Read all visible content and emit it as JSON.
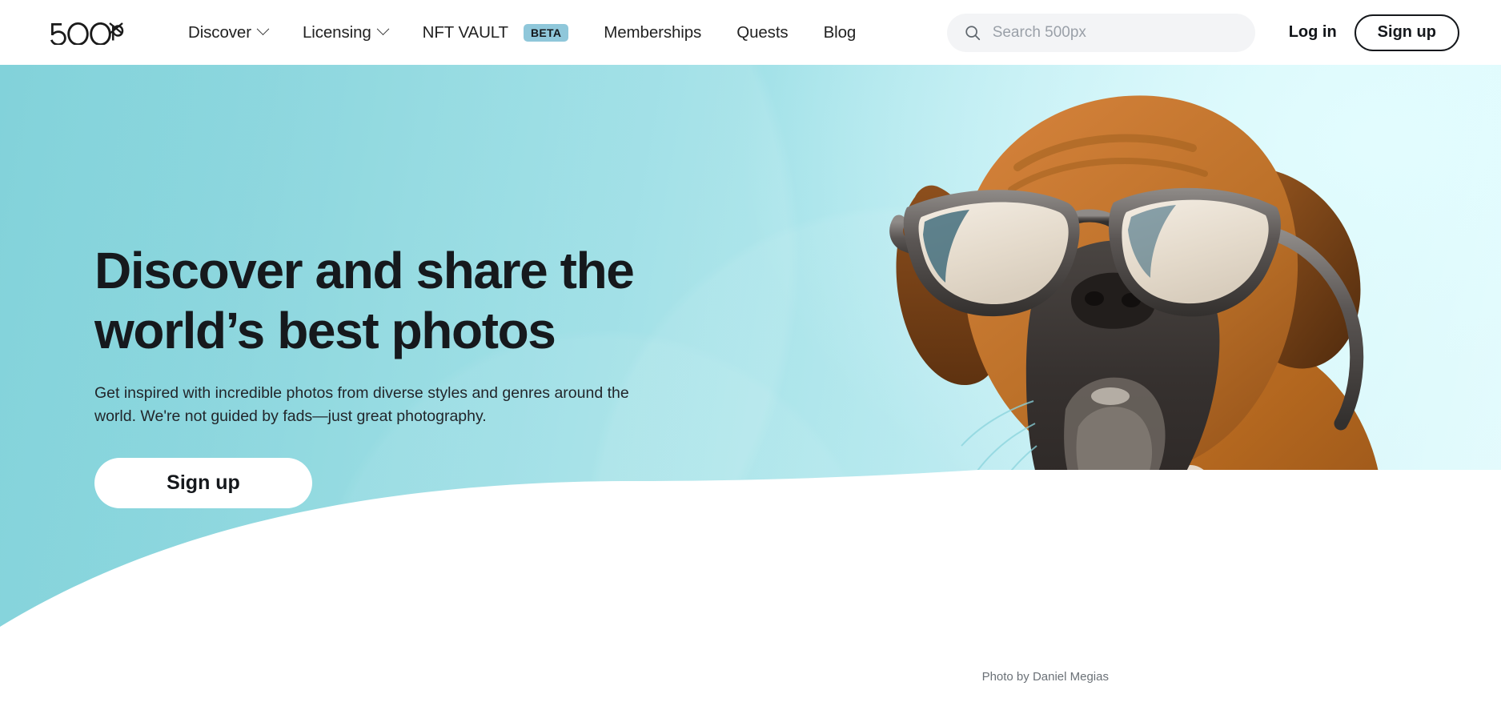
{
  "brand": {
    "logo_text": "500px",
    "logo_icon": "500px-logo"
  },
  "nav": {
    "items": [
      {
        "label": "Discover",
        "has_dropdown": true,
        "badge": null
      },
      {
        "label": "Licensing",
        "has_dropdown": true,
        "badge": null
      },
      {
        "label": "NFT VAULT",
        "has_dropdown": false,
        "badge": "BETA"
      },
      {
        "label": "Memberships",
        "has_dropdown": false,
        "badge": null
      },
      {
        "label": "Quests",
        "has_dropdown": false,
        "badge": null
      },
      {
        "label": "Blog",
        "has_dropdown": false,
        "badge": null
      }
    ],
    "search": {
      "placeholder": "Search 500px",
      "value": "",
      "icon": "search-icon"
    },
    "login_label": "Log in",
    "signup_label": "Sign up"
  },
  "hero": {
    "title_line_1": "Discover and share the",
    "title_line_2": "world’s best photos",
    "subtitle": "Get inspired with incredible photos from diverse styles and genres around the world. We're not guided by fads—just great photography.",
    "cta_label": "Sign up",
    "photo_credit": "Photo by Daniel Megias",
    "image_subject": "boxer-dog-wearing-sunglasses"
  },
  "colors": {
    "hero_gradient_left": "#74cdd6",
    "hero_gradient_right": "#e6fbfd",
    "beta_badge_bg": "#8fc7da",
    "text_primary": "#16191d",
    "search_bg": "#f3f4f6",
    "wave_white": "#ffffff"
  }
}
